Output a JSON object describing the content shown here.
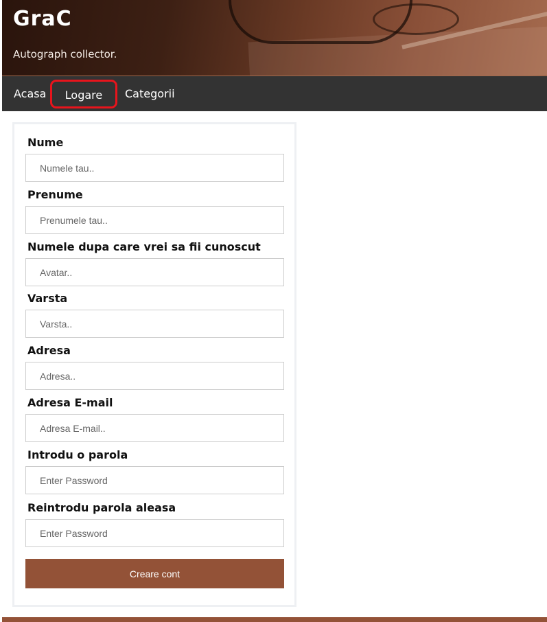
{
  "header": {
    "title": "GraC",
    "subtitle": "Autograph collector."
  },
  "nav": {
    "items": [
      {
        "label": "Acasa"
      },
      {
        "label": "Logare",
        "highlighted": true
      },
      {
        "label": "Categorii"
      }
    ]
  },
  "form": {
    "fields": [
      {
        "label": "Nume",
        "placeholder": "Numele tau..",
        "value": ""
      },
      {
        "label": "Prenume",
        "placeholder": "Prenumele tau..",
        "value": ""
      },
      {
        "label": "Numele dupa care vrei sa fii cunoscut",
        "placeholder": "Avatar..",
        "value": ""
      },
      {
        "label": "Varsta",
        "placeholder": "Varsta..",
        "value": ""
      },
      {
        "label": "Adresa",
        "placeholder": "Adresa..",
        "value": ""
      },
      {
        "label": "Adresa E-mail",
        "placeholder": "Adresa E-mail..",
        "value": ""
      },
      {
        "label": "Introdu o parola",
        "placeholder": "Enter Password",
        "value": ""
      },
      {
        "label": "Reintrodu parola aleasa",
        "placeholder": "Enter Password",
        "value": ""
      }
    ],
    "submit_label": "Creare cont"
  },
  "colors": {
    "nav_background": "#333333",
    "accent_brown": "#935237",
    "highlight_outline": "#e8141c"
  }
}
